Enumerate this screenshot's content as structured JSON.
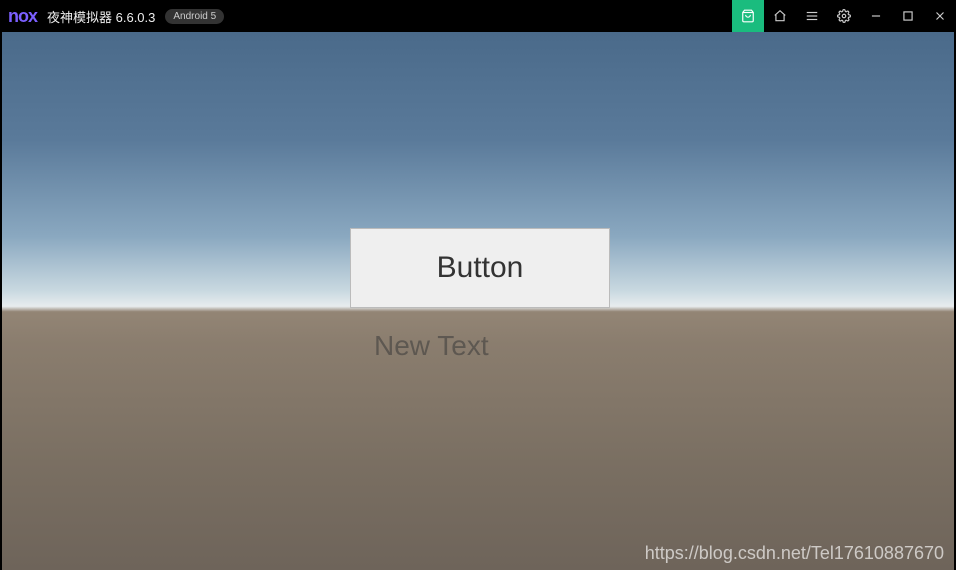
{
  "titlebar": {
    "logo": "nox",
    "title": "夜神模拟器 6.6.0.3",
    "badge": "Android 5"
  },
  "scene": {
    "button_label": "Button",
    "text_label": "New Text",
    "watermark": "https://blog.csdn.net/Tel17610887670"
  }
}
